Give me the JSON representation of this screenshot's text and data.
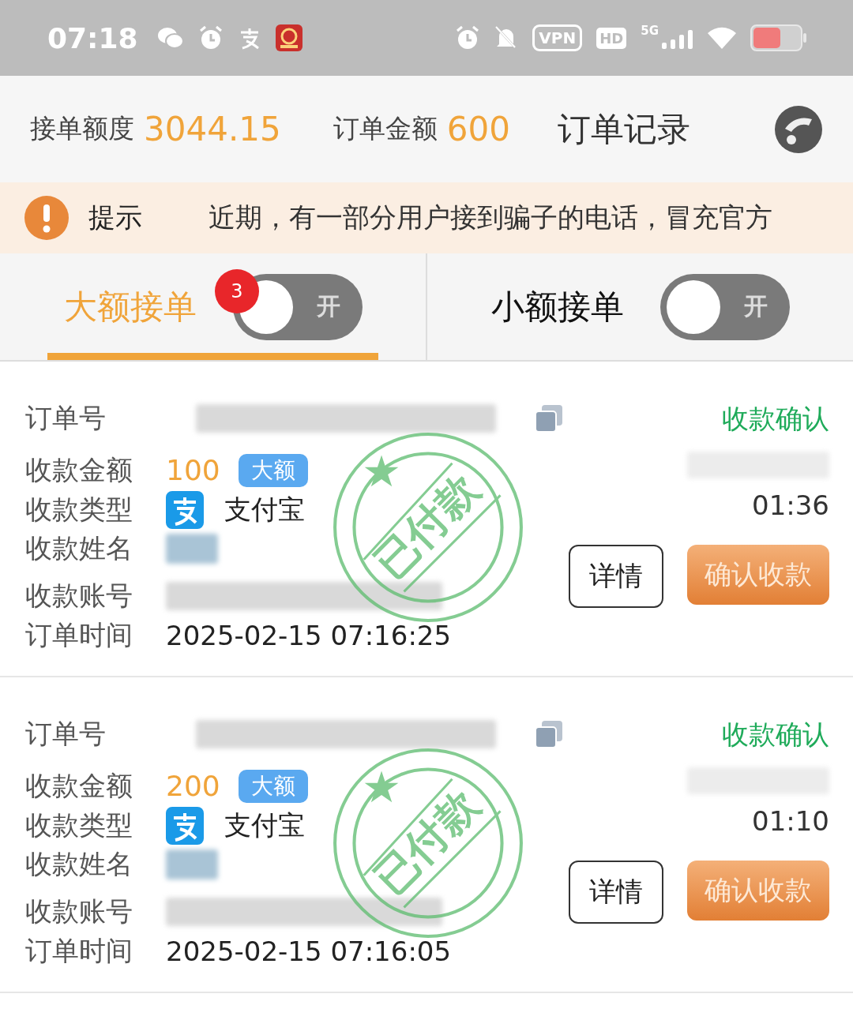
{
  "status_bar": {
    "time": "07:18",
    "vpn": "VPN",
    "hd": "HD",
    "network": "5G"
  },
  "header": {
    "quota_label": "接单额度",
    "quota": "3044.15",
    "amount_label": "订单金额",
    "amount": "600",
    "records": "订单记录"
  },
  "notice": {
    "label": "提示",
    "text": "近期，有一部分用户接到骗子的电话，冒充官方"
  },
  "tabs": [
    {
      "label": "大额接单",
      "selected": true,
      "badge": "3",
      "toggle": {
        "label": "开",
        "on": false
      }
    },
    {
      "label": "小额接单",
      "selected": false,
      "toggle": {
        "label": "开",
        "on": false
      }
    }
  ],
  "orders": [
    {
      "number_label": "订单号",
      "status": "收款确认",
      "amount_label": "收款金额",
      "amount": "100",
      "tag": "大额",
      "type_label": "收款类型",
      "type": "支付宝",
      "name_label": "收款姓名",
      "account_label": "收款账号",
      "time_label": "订单时间",
      "time": "2025-02-15 07:16:25",
      "countdown": "01:36",
      "stamp": "已付款",
      "details": "详情",
      "confirm": "确认收款"
    },
    {
      "number_label": "订单号",
      "status": "收款确认",
      "amount_label": "收款金额",
      "amount": "200",
      "tag": "大额",
      "type_label": "收款类型",
      "type": "支付宝",
      "name_label": "收款姓名",
      "account_label": "收款账号",
      "time_label": "订单时间",
      "time": "2025-02-15 07:16:05",
      "countdown": "01:10",
      "stamp": "已付款",
      "details": "详情",
      "confirm": "确认收款"
    }
  ]
}
